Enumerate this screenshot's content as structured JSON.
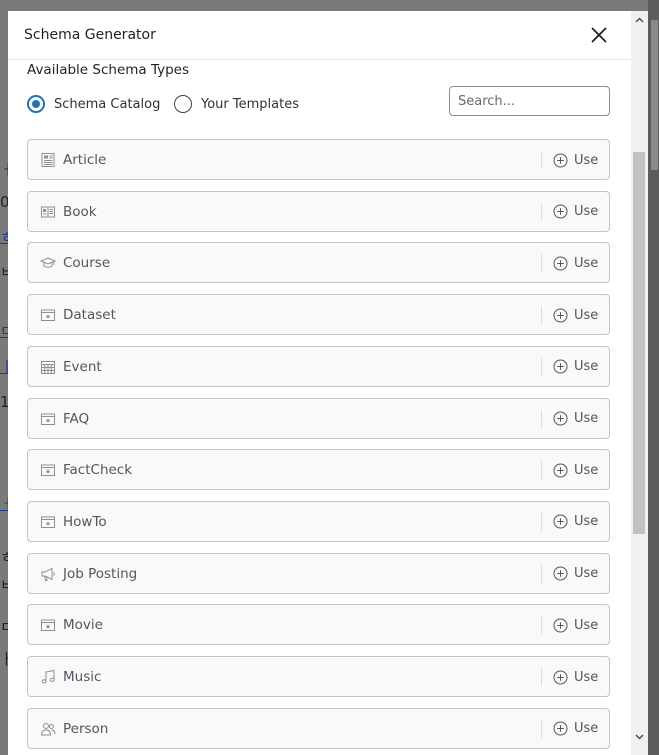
{
  "modal": {
    "title": "Schema Generator",
    "section_label": "Available Schema Types",
    "tabs": [
      {
        "label": "Schema Catalog",
        "checked": true
      },
      {
        "label": "Your Templates",
        "checked": false
      }
    ],
    "search": {
      "placeholder": "Search...",
      "value": ""
    },
    "use_label": "Use",
    "accent_color": "#2271b1",
    "items": [
      {
        "label": "Article",
        "icon": "article-icon"
      },
      {
        "label": "Book",
        "icon": "book-icon"
      },
      {
        "label": "Course",
        "icon": "graduation-cap-icon"
      },
      {
        "label": "Dataset",
        "icon": "schema-card-icon"
      },
      {
        "label": "Event",
        "icon": "calendar-icon"
      },
      {
        "label": "FAQ",
        "icon": "schema-card-icon"
      },
      {
        "label": "FactCheck",
        "icon": "schema-card-icon"
      },
      {
        "label": "HowTo",
        "icon": "schema-card-icon"
      },
      {
        "label": "Job Posting",
        "icon": "megaphone-icon"
      },
      {
        "label": "Movie",
        "icon": "schema-card-icon"
      },
      {
        "label": "Music",
        "icon": "music-note-icon"
      },
      {
        "label": "Person",
        "icon": "people-icon"
      }
    ]
  }
}
